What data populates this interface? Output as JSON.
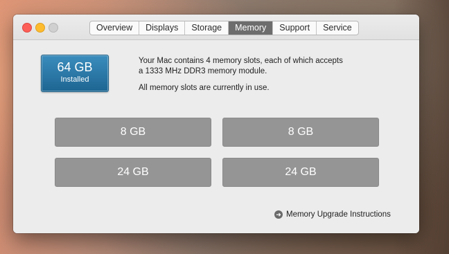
{
  "window": {
    "tabs": [
      {
        "label": "Overview"
      },
      {
        "label": "Displays"
      },
      {
        "label": "Storage"
      },
      {
        "label": "Memory"
      },
      {
        "label": "Support"
      },
      {
        "label": "Service"
      }
    ],
    "active_tab": "Memory"
  },
  "memory": {
    "installed_size": "64 GB",
    "installed_label": "Installed",
    "description_line1": "Your Mac contains 4 memory slots, each of which accepts",
    "description_line2": "a 1333 MHz DDR3 memory module.",
    "status_text": "All memory slots are currently in use.",
    "slots": [
      {
        "size": "8 GB"
      },
      {
        "size": "8 GB"
      },
      {
        "size": "24 GB"
      },
      {
        "size": "24 GB"
      }
    ],
    "upgrade_link": "Memory Upgrade Instructions",
    "upgrade_icon": "arrow-right-circle-icon"
  },
  "colors": {
    "accent_blue": "#2a78a8",
    "slot_gray": "#959595",
    "active_tab": "#6d6d6d",
    "close": "#fc5f57",
    "minimize": "#fdbb2e"
  }
}
